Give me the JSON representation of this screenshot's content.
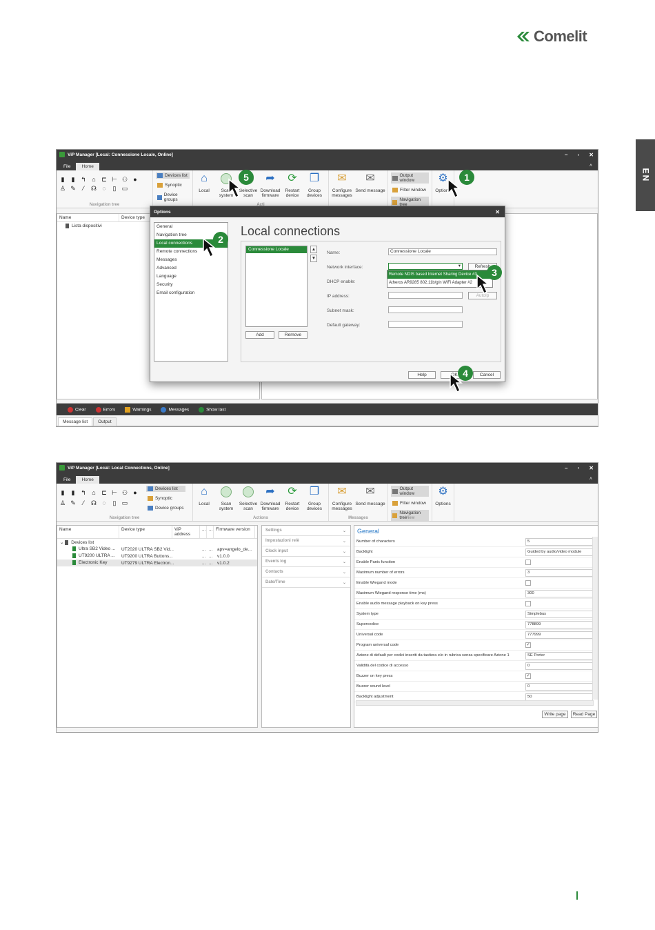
{
  "brand": {
    "name": "Comelit",
    "mark_color": "#2a8a3a"
  },
  "lang_tab": "EN",
  "window1": {
    "title": "ViP Manager [Local: Connessione Locale, Online]",
    "tabs": [
      "File",
      "Home"
    ],
    "ribbon": {
      "list_buttons": [
        "Devices list",
        "Synoptic",
        "Device groups"
      ],
      "nav_group": "Navigation tree",
      "buttons": [
        {
          "label": "Local",
          "icon": "home-icon"
        },
        {
          "label": "Scan system",
          "icon": "scan-icon"
        },
        {
          "label": "Selective scan",
          "icon": "selective-scan-icon"
        },
        {
          "label": "Download firmware",
          "icon": "download-icon"
        },
        {
          "label": "Restart device",
          "icon": "restart-icon"
        },
        {
          "label": "Group devices",
          "icon": "group-icon"
        },
        {
          "label": "Configure messages",
          "icon": "configure-icon"
        },
        {
          "label": "Send message",
          "icon": "mail-icon"
        }
      ],
      "view_buttons": [
        "Output window",
        "Filter window",
        "Navigation tree"
      ],
      "options": "Options",
      "group_partial": "Acti"
    },
    "tree_headers": [
      "Name",
      "Device type"
    ],
    "tree_item": "Lista dispositivi"
  },
  "dialog": {
    "title": "Options",
    "nav": [
      "General",
      "Navigation tree",
      "Local connections",
      "Remote connections",
      "Messages",
      "Advanced",
      "Language",
      "Security",
      "Email configuration"
    ],
    "heading": "Local connections",
    "connection": "Connessione Locale",
    "add": "Add",
    "remove": "Remove",
    "fields": {
      "name_label": "Name:",
      "name_value": "Connessione Locale",
      "netif_label": "Network interface:",
      "dhcp_label": "DHCP enable:",
      "ip_label": "IP address:",
      "mask_label": "Subnet mask:",
      "gw_label": "Default gateway:"
    },
    "refresh": "Refresh",
    "autoip": "AutoIp",
    "options": [
      "Remote NDIS based Internet Sharing Device #3",
      "Atheros AR9285 802.11b/g/n WiFi Adapter #2"
    ],
    "help": "Help",
    "ok": "OK",
    "cancel": "Cancel"
  },
  "messages": {
    "buttons": [
      "Clear",
      "Errors",
      "Warnings",
      "Messages",
      "Show last"
    ],
    "tabs": [
      "Message list",
      "Output"
    ]
  },
  "window2": {
    "title": "ViP Manager [Local: Local Connections, Online]",
    "tabs": [
      "File",
      "Home"
    ],
    "groups": [
      "Navigation tree",
      "Actions",
      "Messages",
      "View"
    ],
    "tree_headers": [
      "Name",
      "Device type",
      "ViP address",
      "...",
      "...",
      "Firmware version"
    ],
    "root": "Devices list",
    "devices": [
      {
        "name": "Ultra SB2 Video ...",
        "type": "UT2020 ULTRA SB2 Vid...",
        "addr": "...",
        "sep": "...",
        "fw": "apv=angelo_de..."
      },
      {
        "name": "UT9200 ULTRA ...",
        "type": "UT9200 ULTRA Buttons...",
        "addr": "...",
        "sep": "...",
        "fw": "v1.0.0"
      },
      {
        "name": "Electronic Key",
        "type": "UT9279 ULTRA Electron...",
        "addr": "...",
        "sep": "...",
        "fw": "v1.0.2"
      }
    ],
    "sections": [
      "Settings",
      "Impostazioni relè",
      "Clock input",
      "Events log",
      "Contacts",
      "Date/Time"
    ],
    "general_title": "General",
    "props": [
      {
        "n": "Number of characters",
        "v": "5"
      },
      {
        "n": "Backlight",
        "v": "Guided by audio/video module"
      },
      {
        "n": "Enable Panic function",
        "chk": ""
      },
      {
        "n": "Maximum number of errors",
        "v": "3"
      },
      {
        "n": "Enable Wiegand mode",
        "chk": ""
      },
      {
        "n": "Maximum Wiegand response time (ms)",
        "v": "300"
      },
      {
        "n": "Enable audio message playback on key press",
        "chk": ""
      },
      {
        "n": "System type",
        "v": "Simplebus"
      },
      {
        "n": "Supercodice",
        "v": "778899"
      },
      {
        "n": "Universal code",
        "v": "777999"
      },
      {
        "n": "Program universal code",
        "chk": "✓"
      },
      {
        "n": "Azione di default per codici inseriti da tastiera e/o in rubrica senza specificare Azione 1",
        "v": "SE Porter"
      },
      {
        "n": "Validità del codice di accesso",
        "v": "0"
      },
      {
        "n": "Buzzer on key press",
        "chk": "✓"
      },
      {
        "n": "Buzzer sound level",
        "v": "0"
      },
      {
        "n": "Backlight adjustment",
        "v": "50"
      }
    ],
    "write": "Write page",
    "read": "Read Page"
  },
  "callouts": [
    "1",
    "2",
    "3",
    "4",
    "5"
  ]
}
